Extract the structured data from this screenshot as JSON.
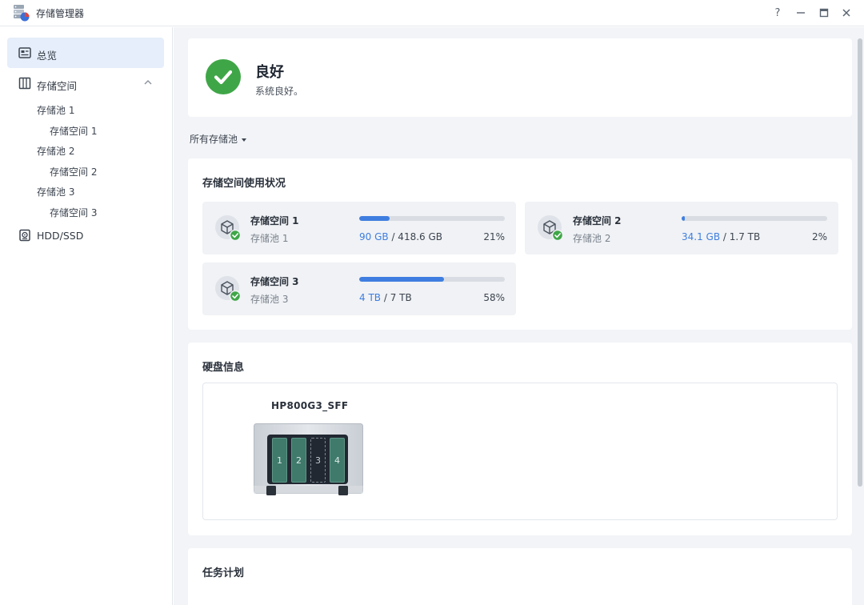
{
  "window": {
    "title": "存储管理器",
    "controls": {
      "help": "?"
    }
  },
  "sidebar": {
    "overview": "总览",
    "storage": {
      "label": "存储空间",
      "children": [
        {
          "pool": "存储池 1",
          "volume": "存储空间 1"
        },
        {
          "pool": "存储池 2",
          "volume": "存储空间 2"
        },
        {
          "pool": "存储池 3",
          "volume": "存储空间 3"
        }
      ]
    },
    "hdd": "HDD/SSD"
  },
  "status": {
    "title": "良好",
    "description": "系统良好。",
    "color": "#3fa647"
  },
  "filter": {
    "label": "所有存储池"
  },
  "usage": {
    "title": "存储空间使用状况",
    "accent": "#3f7ee0",
    "volumes": [
      {
        "name": "存储空间 1",
        "pool": "存储池 1",
        "used": "90 GB",
        "total": "/ 418.6 GB",
        "percent": "21%",
        "fill": 0.21
      },
      {
        "name": "存储空间 2",
        "pool": "存储池 2",
        "used": "34.1 GB",
        "total": "/ 1.7 TB",
        "percent": "2%",
        "fill": 0.02
      },
      {
        "name": "存储空间 3",
        "pool": "存储池 3",
        "used": "4 TB",
        "total": "/ 7 TB",
        "percent": "58%",
        "fill": 0.58
      }
    ]
  },
  "disk": {
    "title": "硬盘信息",
    "device": "HP800G3_SFF",
    "bays": [
      {
        "label": "1",
        "state": "installed"
      },
      {
        "label": "2",
        "state": "installed"
      },
      {
        "label": "3",
        "state": "empty"
      },
      {
        "label": "4",
        "state": "installed"
      }
    ]
  },
  "tasks": {
    "title": "任务计划"
  }
}
